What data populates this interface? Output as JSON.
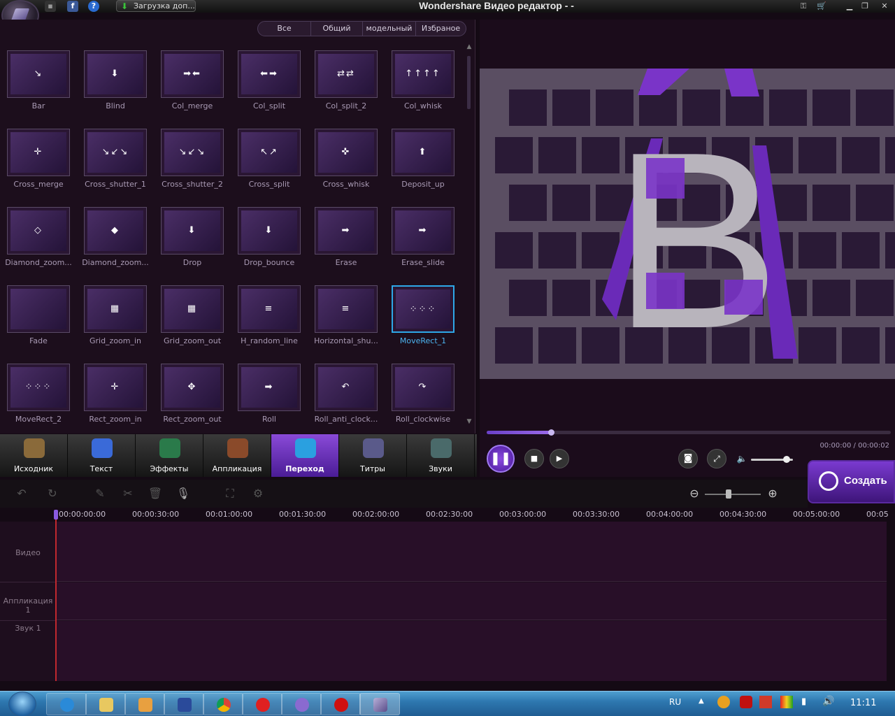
{
  "window": {
    "title": "Wondershare Видео редактор - -",
    "download_label": "Загрузка доп..."
  },
  "filter": {
    "tabs": [
      {
        "label": "Все",
        "active": true
      },
      {
        "label": "Общий",
        "active": false
      },
      {
        "label": "модельный",
        "active": false
      },
      {
        "label": "Избраное",
        "active": false
      }
    ]
  },
  "transitions": [
    {
      "label": "Bar",
      "glyph": "↘"
    },
    {
      "label": "Blind",
      "glyph": "⬇"
    },
    {
      "label": "Col_merge",
      "glyph": "➡⬅"
    },
    {
      "label": "Col_split",
      "glyph": "⬅➡"
    },
    {
      "label": "Col_split_2",
      "glyph": "⇄⇄"
    },
    {
      "label": "Col_whisk",
      "glyph": "↑↑↑↑"
    },
    {
      "label": "Cross_merge",
      "glyph": "✛"
    },
    {
      "label": "Cross_shutter_1",
      "glyph": "↘↙↘"
    },
    {
      "label": "Cross_shutter_2",
      "glyph": "↘↙↘"
    },
    {
      "label": "Cross_split",
      "glyph": "↖↗"
    },
    {
      "label": "Cross_whisk",
      "glyph": "✜"
    },
    {
      "label": "Deposit_up",
      "glyph": "⬆"
    },
    {
      "label": "Diamond_zoom...",
      "glyph": "◇"
    },
    {
      "label": "Diamond_zoom...",
      "glyph": "◆"
    },
    {
      "label": "Drop",
      "glyph": "⬇"
    },
    {
      "label": "Drop_bounce",
      "glyph": "⬇"
    },
    {
      "label": "Erase",
      "glyph": "➡"
    },
    {
      "label": "Erase_slide",
      "glyph": "➡"
    },
    {
      "label": "Fade",
      "glyph": ""
    },
    {
      "label": "Grid_zoom_in",
      "glyph": "▦"
    },
    {
      "label": "Grid_zoom_out",
      "glyph": "▦"
    },
    {
      "label": "H_random_line",
      "glyph": "≡"
    },
    {
      "label": "Horizontal_shu...",
      "glyph": "≡"
    },
    {
      "label": "MoveRect_1",
      "glyph": "⁘⁘⁘"
    },
    {
      "label": "MoveRect_2",
      "glyph": "⁘⁘⁘"
    },
    {
      "label": "Rect_zoom_in",
      "glyph": "✛"
    },
    {
      "label": "Rect_zoom_out",
      "glyph": "✥"
    },
    {
      "label": "Roll",
      "glyph": "➡"
    },
    {
      "label": "Roll_anti_clock...",
      "glyph": "↶"
    },
    {
      "label": "Roll_clockwise",
      "glyph": "↷"
    }
  ],
  "selected_transition_index": 23,
  "categories": [
    {
      "label": "Исходник",
      "color": "#8a6a3a",
      "active": false
    },
    {
      "label": "Текст",
      "color": "#3a6ad8",
      "active": false
    },
    {
      "label": "Эффекты",
      "color": "#2a7a4a",
      "active": false
    },
    {
      "label": "Аппликация",
      "color": "#8a4a2a",
      "active": false
    },
    {
      "label": "Переход",
      "color": "#2aa0e0",
      "active": true
    },
    {
      "label": "Титры",
      "color": "#5a5a8a",
      "active": false
    },
    {
      "label": "Звуки",
      "color": "#4a6a6a",
      "active": false
    }
  ],
  "player": {
    "timecode": "00:00:00 / 00:00:02",
    "progress": 0.16,
    "volume": 0.85,
    "create_label": "Создать",
    "preview_letter": "B"
  },
  "timeline": {
    "ticks": [
      "00:00:00:00",
      "00:00:30:00",
      "00:01:00:00",
      "00:01:30:00",
      "00:02:00:00",
      "00:02:30:00",
      "00:03:00:00",
      "00:03:30:00",
      "00:04:00:00",
      "00:04:30:00",
      "00:05:00:00",
      "00:05"
    ],
    "tracks": [
      "Видео",
      "Аппликация 1",
      "Звук 1"
    ]
  },
  "taskbar": {
    "lang": "RU",
    "clock": "11:11"
  },
  "colors": {
    "accent": "#7a3ad0",
    "selected_border": "#2ea8e8"
  }
}
